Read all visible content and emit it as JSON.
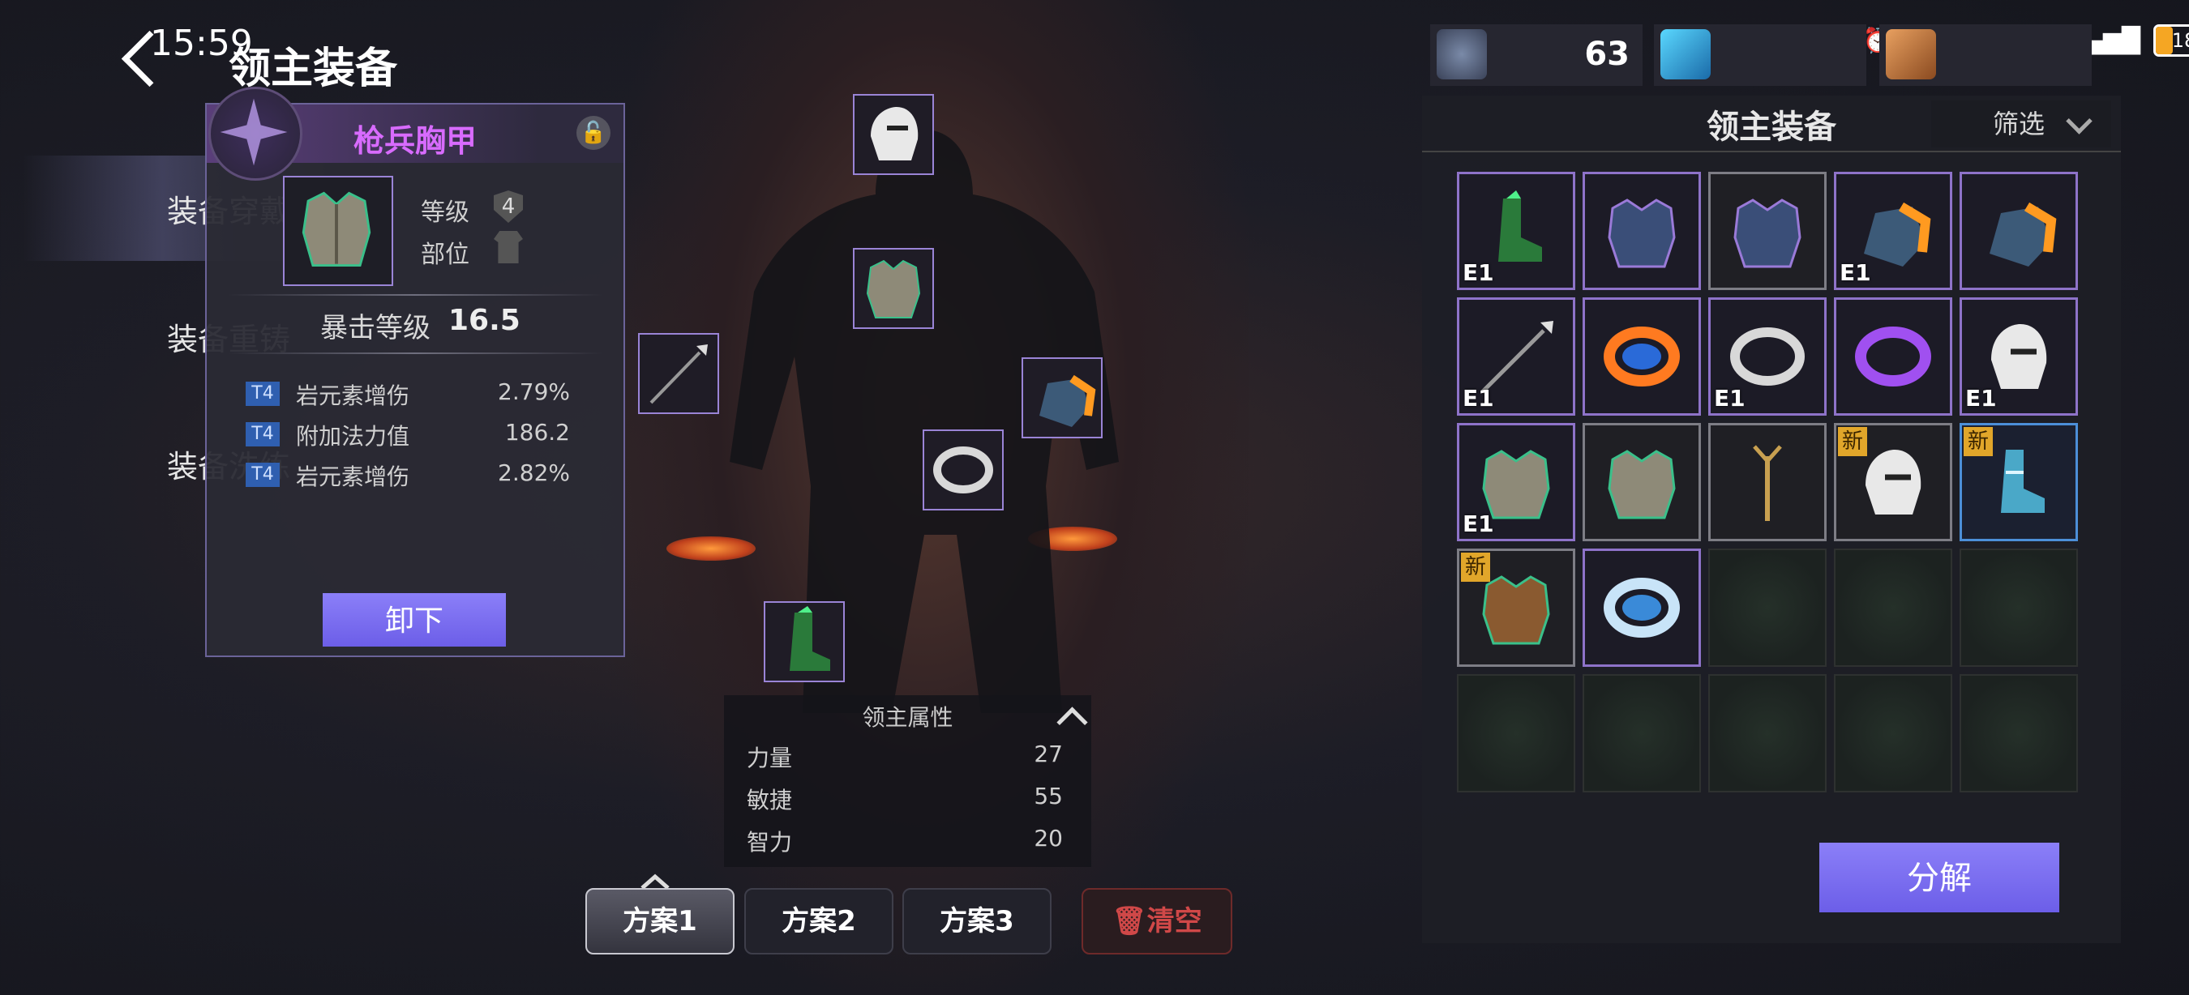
{
  "status_bar": {
    "time": "15:59",
    "network": "4G",
    "network2": "4G",
    "battery": "18"
  },
  "header": {
    "title": "领主装备"
  },
  "side_menu": {
    "items": [
      "装备穿戴",
      "装备重铸",
      "装备洗练"
    ],
    "active_index": 0
  },
  "detail": {
    "name": "枪兵胸甲",
    "level_label": "等级",
    "level_value": "4",
    "slot_label": "部位",
    "main_stat_label": "暴击等级",
    "main_stat_value": "16.5",
    "sub_stats": [
      {
        "tier": "T4",
        "name": "岩元素增伤",
        "value": "2.79%"
      },
      {
        "tier": "T4",
        "name": "附加法力值",
        "value": "186.2"
      },
      {
        "tier": "T4",
        "name": "岩元素增伤",
        "value": "2.82%"
      }
    ],
    "unequip_label": "卸下",
    "name_color": "#d86bff"
  },
  "attributes": {
    "title": "领主属性",
    "rows": [
      {
        "name": "力量",
        "value": "27"
      },
      {
        "name": "敏捷",
        "value": "55"
      },
      {
        "name": "智力",
        "value": "20"
      }
    ]
  },
  "plans": {
    "items": [
      "方案1",
      "方案2",
      "方案3"
    ],
    "active_index": 0,
    "clear_label": "清空"
  },
  "resources": [
    {
      "icon": "ore-icon",
      "value": "63"
    },
    {
      "icon": "crystal-icon",
      "value": ""
    },
    {
      "icon": "material-icon",
      "value": ""
    }
  ],
  "inventory": {
    "title": "领主装备",
    "filter_label": "筛选",
    "decompose_label": "分解",
    "items": [
      {
        "type": "boots-green-icon",
        "frame": "purple",
        "badge": "E1"
      },
      {
        "type": "chest-blue-icon",
        "frame": "purple",
        "badge": ""
      },
      {
        "type": "chest-blue-icon",
        "frame": "gray",
        "badge": ""
      },
      {
        "type": "gauntlet-fire-icon",
        "frame": "purple",
        "badge": "E1"
      },
      {
        "type": "gauntlet-fire-icon",
        "frame": "purple",
        "badge": ""
      },
      {
        "type": "spear-icon",
        "frame": "purple",
        "badge": "E1"
      },
      {
        "type": "ring-fire-icon",
        "frame": "purple",
        "badge": ""
      },
      {
        "type": "ring-silver-icon",
        "frame": "purple",
        "badge": "E1"
      },
      {
        "type": "ring-purple-icon",
        "frame": "purple",
        "badge": ""
      },
      {
        "type": "helmet-white-icon",
        "frame": "purple",
        "badge": "E1"
      },
      {
        "type": "chest-silver-icon",
        "frame": "purple",
        "badge": "E1"
      },
      {
        "type": "chest-silver-icon",
        "frame": "gray",
        "badge": ""
      },
      {
        "type": "staff-icon",
        "frame": "gray",
        "badge": ""
      },
      {
        "type": "helmet-white-icon",
        "frame": "gray",
        "badge": "",
        "new": "新"
      },
      {
        "type": "boots-ice-icon",
        "frame": "blue",
        "badge": "",
        "new": "新"
      },
      {
        "type": "chest-bronze-icon",
        "frame": "gray",
        "badge": "",
        "new": "新"
      },
      {
        "type": "ring-ice-icon",
        "frame": "purple",
        "badge": ""
      },
      {
        "type": "empty",
        "frame": "empty",
        "badge": ""
      },
      {
        "type": "empty",
        "frame": "empty",
        "badge": ""
      },
      {
        "type": "empty",
        "frame": "empty",
        "badge": ""
      },
      {
        "type": "empty",
        "frame": "empty",
        "badge": ""
      },
      {
        "type": "empty",
        "frame": "empty",
        "badge": ""
      },
      {
        "type": "empty",
        "frame": "empty",
        "badge": ""
      },
      {
        "type": "empty",
        "frame": "empty",
        "badge": ""
      },
      {
        "type": "empty",
        "frame": "empty",
        "badge": ""
      }
    ]
  },
  "equipped_slots": [
    {
      "name": "helmet",
      "icon": "helmet-white-icon"
    },
    {
      "name": "chest",
      "icon": "chest-silver-icon"
    },
    {
      "name": "weapon",
      "icon": "spear-icon"
    },
    {
      "name": "gloves",
      "icon": "gauntlet-fire-icon"
    },
    {
      "name": "ring",
      "icon": "ring-silver-icon"
    },
    {
      "name": "boots",
      "icon": "boots-green-icon"
    }
  ]
}
